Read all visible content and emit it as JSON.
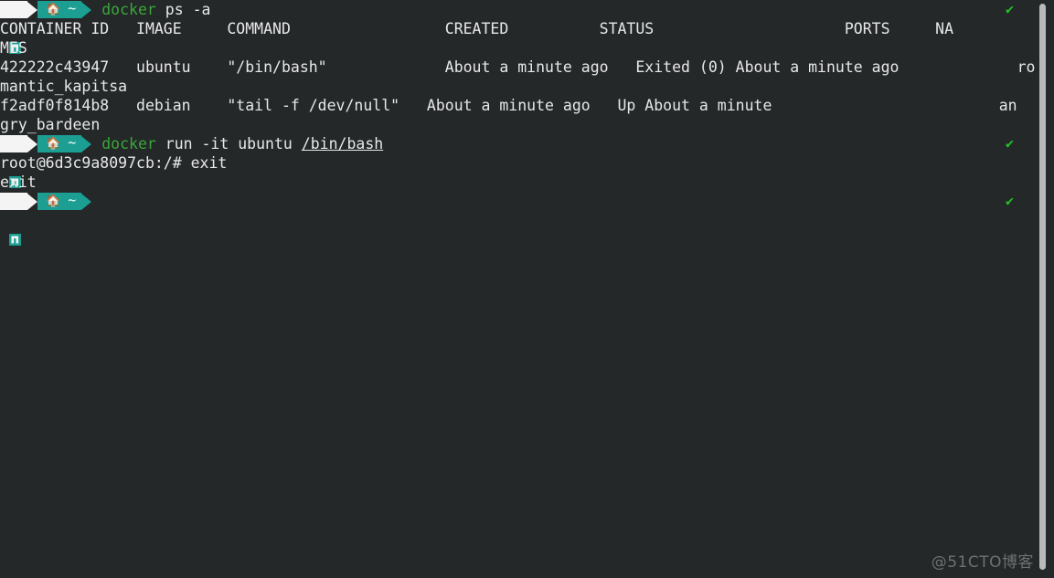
{
  "terminal": {
    "background_color": "#242829",
    "foreground_color": "#e8e8e8",
    "prompt": {
      "logo_icon": "kali-dragon-logo-icon",
      "home_icon": "home-icon",
      "path_label": "~",
      "segment_white_color": "#f4f4f4",
      "segment_teal_color": "#1c9e93",
      "success_mark": "✔",
      "success_color": "#22c322"
    },
    "command_keyword_color": "#3aa63a",
    "lines": [
      {
        "type": "prompt",
        "command_keyword": "docker",
        "command_rest": " ps -a",
        "status": "✔"
      },
      {
        "type": "output",
        "text": "CONTAINER ID   IMAGE     COMMAND                 CREATED          STATUS                     PORTS     NA"
      },
      {
        "type": "output",
        "text": "MES"
      },
      {
        "type": "output",
        "text": "422222c43947   ubuntu    \"/bin/bash\"             About a minute ago   Exited (0) About a minute ago             ro"
      },
      {
        "type": "output",
        "text": "mantic_kapitsa"
      },
      {
        "type": "output",
        "text": "f2adf0f814b8   debian    \"tail -f /dev/null\"   About a minute ago   Up About a minute                         an"
      },
      {
        "type": "output",
        "text": "gry_bardeen"
      },
      {
        "type": "prompt",
        "command_keyword": "docker",
        "command_rest": " run -it ubuntu ",
        "command_path": "/bin/bash",
        "status": "✔"
      },
      {
        "type": "output",
        "text": "root@6d3c9a8097cb:/# exit"
      },
      {
        "type": "output",
        "text": "exit"
      },
      {
        "type": "prompt",
        "command_keyword": "",
        "command_rest": "",
        "status": "✔"
      }
    ],
    "table": {
      "headers": [
        "CONTAINER ID",
        "IMAGE",
        "COMMAND",
        "CREATED",
        "STATUS",
        "PORTS",
        "NAMES"
      ],
      "rows": [
        {
          "container_id": "422222c43947",
          "image": "ubuntu",
          "command": "\"/bin/bash\"",
          "created": "About a minute ago",
          "status": "Exited (0) About a minute ago",
          "ports": "",
          "names": "romantic_kapitsa"
        },
        {
          "container_id": "f2adf0f814b8",
          "image": "debian",
          "command": "\"tail -f /dev/null\"",
          "created": "About a minute ago",
          "status": "Up About a minute",
          "ports": "",
          "names": "angry_bardeen"
        }
      ]
    },
    "scrollbar": {
      "thumb_color": "#b9b9b9"
    },
    "watermark": "@51CTO博客"
  }
}
